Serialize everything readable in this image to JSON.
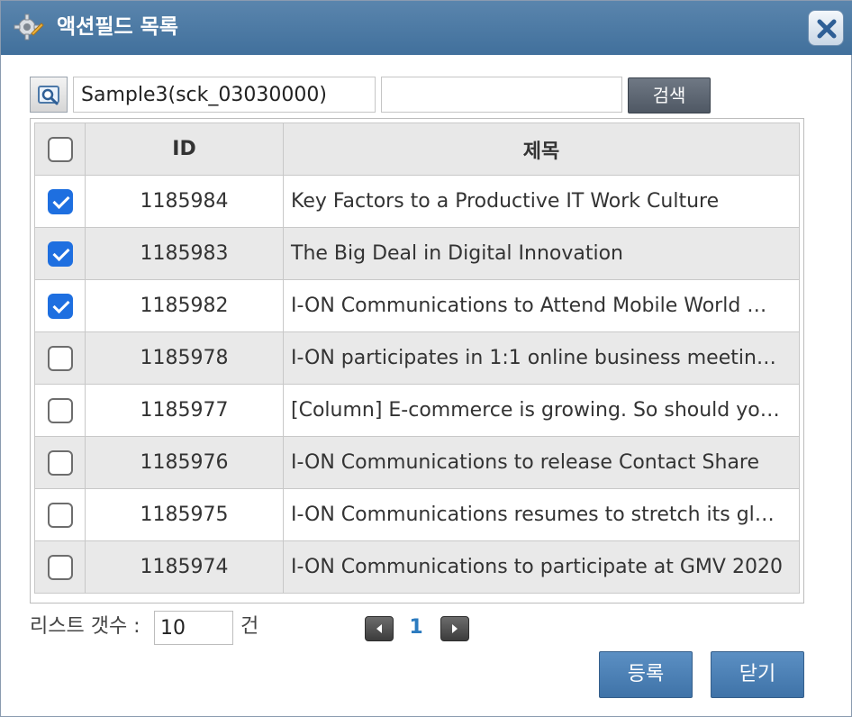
{
  "dialog": {
    "title": "액션필드 목록",
    "title_icon": "gear-icon",
    "close_icon": "close-icon"
  },
  "search": {
    "icon": "search-icon",
    "field_value": "Sample3(sck_03030000)",
    "keyword_value": "",
    "button_label": "검색"
  },
  "table": {
    "headers": {
      "id": "ID",
      "title": "제목"
    },
    "rows": [
      {
        "checked": true,
        "id": "1185984",
        "title": "Key Factors to a Productive IT Work Culture"
      },
      {
        "checked": true,
        "id": "1185983",
        "title": "The Big Deal in Digital Innovation"
      },
      {
        "checked": true,
        "id": "1185982",
        "title": "I-ON Communications to Attend Mobile World …"
      },
      {
        "checked": false,
        "id": "1185978",
        "title": "I-ON participates in 1:1 online business meetin…"
      },
      {
        "checked": false,
        "id": "1185977",
        "title": "[Column] E-commerce is growing. So should yo…"
      },
      {
        "checked": false,
        "id": "1185976",
        "title": "I-ON Communications to release Contact Share"
      },
      {
        "checked": false,
        "id": "1185975",
        "title": "I-ON Communications resumes to stretch its gl…"
      },
      {
        "checked": false,
        "id": "1185974",
        "title": "I-ON Communications to participate at GMV 2020"
      }
    ]
  },
  "footer": {
    "list_count_label": "리스트 갯수 :",
    "list_count_value": "10",
    "list_count_unit": "건",
    "current_page": "1",
    "register_label": "등록",
    "close_label": "닫기"
  },
  "colors": {
    "titlebar": "#41709c",
    "checkbox_checked": "#1e6fe0",
    "action_button": "#4a7fb5",
    "page_number": "#2c7bbf"
  }
}
